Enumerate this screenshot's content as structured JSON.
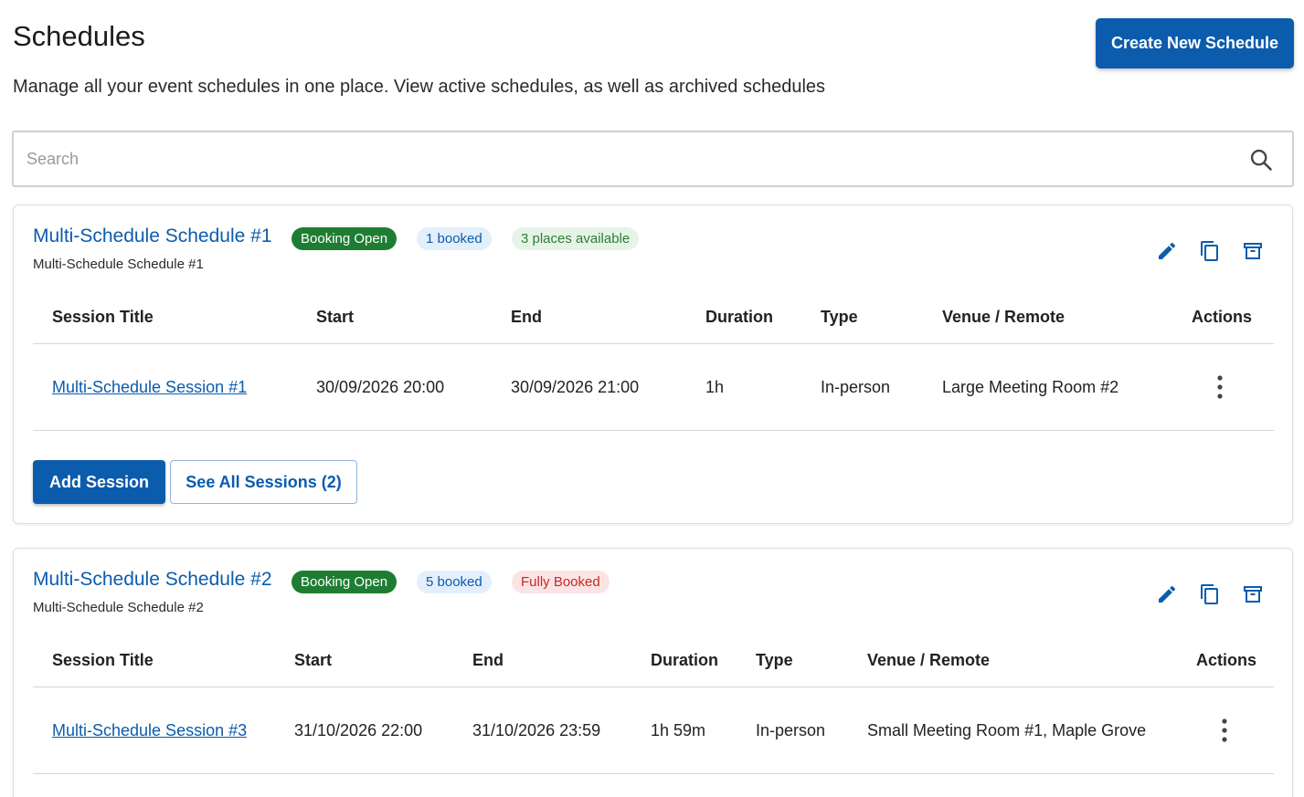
{
  "header": {
    "title": "Schedules",
    "subtitle": "Manage all your event schedules in one place. View active schedules, as well as archived schedules",
    "create_label": "Create New Schedule"
  },
  "search": {
    "placeholder": "Search",
    "value": ""
  },
  "colors": {
    "primary": "#0b5cad",
    "open_badge": "#1e7d32",
    "full_badge_text": "#c62828",
    "avail_badge_text": "#2e7d32"
  },
  "icons": [
    "search-icon",
    "edit-icon",
    "duplicate-icon",
    "archive-icon",
    "more-vert-icon"
  ],
  "schedules": [
    {
      "title": "Multi-Schedule Schedule #1",
      "subtitle": "Multi-Schedule Schedule #1",
      "badges": {
        "status": "Booking Open",
        "booked": "1 booked",
        "availability": "3 places available"
      },
      "columns": [
        "Session Title",
        "Start",
        "End",
        "Duration",
        "Type",
        "Venue / Remote",
        "Actions"
      ],
      "sessions": [
        {
          "title": "Multi-Schedule Session #1",
          "start": "30/09/2026 20:00",
          "end": "30/09/2026 21:00",
          "duration": "1h",
          "type": "In-person",
          "venue": "Large Meeting Room #2"
        }
      ],
      "add_label": "Add Session",
      "see_all_label": "See All Sessions (2)"
    },
    {
      "title": "Multi-Schedule Schedule #2",
      "subtitle": "Multi-Schedule Schedule #2",
      "badges": {
        "status": "Booking Open",
        "booked": "5 booked",
        "availability": "Fully Booked"
      },
      "columns": [
        "Session Title",
        "Start",
        "End",
        "Duration",
        "Type",
        "Venue / Remote",
        "Actions"
      ],
      "sessions": [
        {
          "title": "Multi-Schedule Session #3",
          "start": "31/10/2026 22:00",
          "end": "31/10/2026 23:59",
          "duration": "1h 59m",
          "type": "In-person",
          "venue": "Small Meeting Room #1, Maple Grove"
        }
      ]
    }
  ]
}
